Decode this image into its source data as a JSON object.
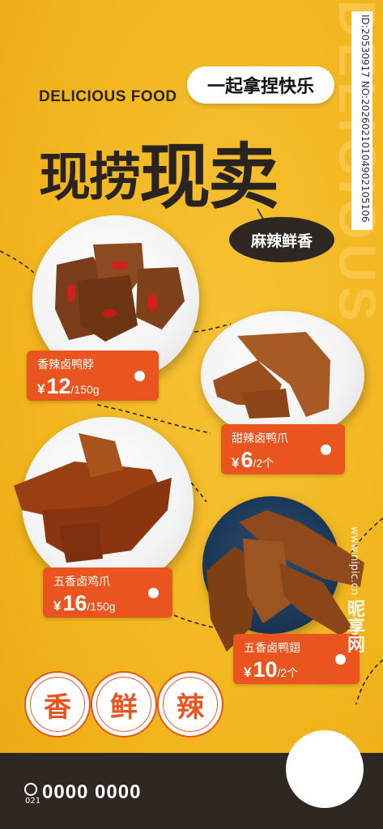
{
  "background_text": "DELICIOUS",
  "side_id": "ID:20530917 NO:20260210104902105106",
  "header": {
    "title_en": "DELICIOUS FOOD",
    "slogan": "一起拿捏快乐",
    "title_cn_a": "现捞",
    "title_cn_b": "现卖",
    "flavor": "麻辣鲜香"
  },
  "products": [
    {
      "name": "香辣卤鸭脖",
      "currency": "¥",
      "price": "12",
      "unit": "/150g"
    },
    {
      "name": "甜辣卤鸭爪",
      "currency": "¥",
      "price": "6",
      "unit": "/2个"
    },
    {
      "name": "五香卤鸡爪",
      "currency": "¥",
      "price": "16",
      "unit": "/150g"
    },
    {
      "name": "五香卤鸭翅",
      "currency": "¥",
      "price": "10",
      "unit": "/2个"
    }
  ],
  "stamps": [
    "香",
    "鲜",
    "辣"
  ],
  "footer": {
    "phone": "0000 0000",
    "area_code": "021"
  },
  "watermark": {
    "logo": "昵享网",
    "url": "www.nipic.cn"
  },
  "colors": {
    "background": "#f2b51d",
    "accent": "#e9541f",
    "dark": "#2f2822"
  }
}
